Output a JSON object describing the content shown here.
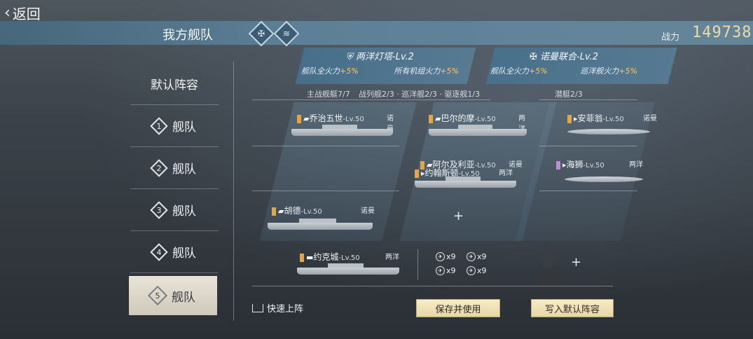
{
  "nav": {
    "back_label": "返回"
  },
  "header": {
    "title": "我方舰队",
    "power_label": "战力",
    "power_value": "149738",
    "icons": [
      "fleet-emblem-icon",
      "rank-emblem-icon"
    ]
  },
  "sidebar": {
    "items": [
      {
        "label": "默认阵容"
      },
      {
        "num": "1",
        "label": "舰队"
      },
      {
        "num": "2",
        "label": "舰队"
      },
      {
        "num": "3",
        "label": "舰队"
      },
      {
        "num": "4",
        "label": "舰队"
      },
      {
        "num": "5",
        "label": "舰队",
        "selected": true
      }
    ]
  },
  "bonuses": [
    {
      "title": "两洋灯塔-Lv.2",
      "left": "舰队全火力",
      "left_val": "+5%",
      "right": "所有机组火力",
      "right_val": "+5%"
    },
    {
      "title": "诺曼联合-Lv.2",
      "left": "舰队全火力",
      "left_val": "+5%",
      "right": "巡洋舰火力",
      "right_val": "+5%"
    }
  ],
  "columns": {
    "main_header": "主战舰艇7/7",
    "main_sub": "战列舰2/3 · 巡洋舰2/3 · 驱逐舰1/3",
    "sub_header": "潜艇2/3"
  },
  "ships": {
    "col1": [
      {
        "name": "乔治五世",
        "lv": "-Lv.50",
        "faction": "诺曼",
        "tag_color": "#e0a64a"
      },
      {
        "name": "胡德",
        "lv": "-Lv.50",
        "faction": "诺曼",
        "tag_color": "#e0a64a"
      }
    ],
    "col2": [
      {
        "name": "巴尔的摩",
        "lv": "-Lv.50",
        "faction": "两洋",
        "tag_color": "#e0a64a"
      },
      {
        "name": "阿尔及利亚",
        "lv": "-Lv.50",
        "faction": "诺曼",
        "tag_color": "#e0a64a"
      },
      {
        "name": "约翰斯顿",
        "lv": "-Lv.50",
        "faction": "两洋",
        "tag_color": "#e0a64a"
      }
    ],
    "carrier": {
      "name": "约克城",
      "lv": "-Lv.50",
      "faction": "两洋",
      "tag_color": "#e0a64a"
    },
    "subs": [
      {
        "name": "安菲翁",
        "lv": "-Lv.50",
        "faction": "诺曼",
        "tag_color": "#e0a64a"
      },
      {
        "name": "海狮",
        "lv": "-Lv.50",
        "faction": "两洋",
        "tag_color": "#b98fd8"
      }
    ]
  },
  "planes": [
    "x9",
    "x9",
    "x9",
    "x9"
  ],
  "actions": {
    "quick_label": "快速上阵",
    "save_label": "保存并使用",
    "default_label": "写入默认阵容"
  }
}
